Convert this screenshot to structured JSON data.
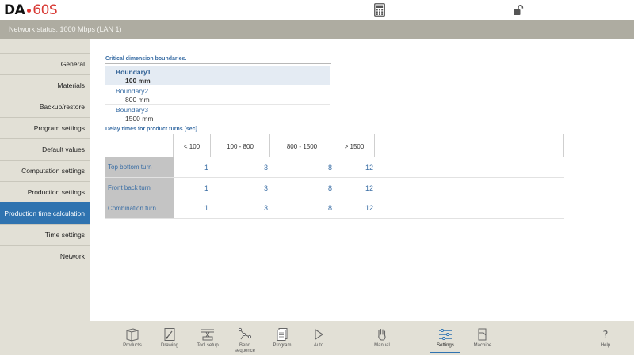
{
  "app": {
    "logo_brand": "DA",
    "logo_model": "60S",
    "network_status": "Network status: 1000 Mbps (LAN 1)",
    "top_icons": [
      "calculator-icon",
      "unlock-icon"
    ]
  },
  "sidebar": {
    "items": [
      {
        "label": "General"
      },
      {
        "label": "Materials"
      },
      {
        "label": "Backup/restore"
      },
      {
        "label": "Program settings"
      },
      {
        "label": "Default values"
      },
      {
        "label": "Computation settings"
      },
      {
        "label": "Production settings"
      },
      {
        "label": "Production time calculation",
        "active": true
      },
      {
        "label": "Time settings"
      },
      {
        "label": "Network"
      }
    ]
  },
  "boundaries": {
    "title": "Critical dimension boundaries.",
    "items": [
      {
        "name": "Boundary1",
        "value": "100 mm",
        "selected": true
      },
      {
        "name": "Boundary2",
        "value": "800 mm"
      },
      {
        "name": "Boundary3",
        "value": "1500 mm"
      }
    ]
  },
  "delays": {
    "title": "Delay times for product turns [sec]",
    "columns": [
      "< 100",
      "100 - 800",
      "800 - 1500",
      "> 1500"
    ],
    "rows": [
      {
        "label": "Top bottom turn",
        "values": [
          "1",
          "3",
          "8",
          "12"
        ]
      },
      {
        "label": "Front back turn",
        "values": [
          "1",
          "3",
          "8",
          "12"
        ]
      },
      {
        "label": "Combination turn",
        "values": [
          "1",
          "3",
          "8",
          "12"
        ]
      }
    ]
  },
  "toolbar": {
    "items": [
      {
        "label": "Products",
        "icon": "products-icon"
      },
      {
        "label": "Drawing",
        "icon": "drawing-icon"
      },
      {
        "label": "Tool setup",
        "icon": "tool-setup-icon"
      },
      {
        "label": "Bend sequence",
        "icon": "bend-sequence-icon"
      },
      {
        "label": "Program",
        "icon": "program-icon"
      },
      {
        "label": "Auto",
        "icon": "auto-play-icon"
      },
      {
        "label": "Manual",
        "icon": "manual-hand-icon"
      },
      {
        "label": "Settings",
        "icon": "settings-icon",
        "active": true
      },
      {
        "label": "Machine",
        "icon": "machine-icon"
      },
      {
        "label": "Help",
        "icon": "help-icon"
      }
    ]
  },
  "colors": {
    "accent": "#2f73b0",
    "status_bar": "#aeaca1",
    "panel": "#e2e0d6",
    "value_text": "#3a6ea5",
    "logo_model": "#d83a35"
  }
}
